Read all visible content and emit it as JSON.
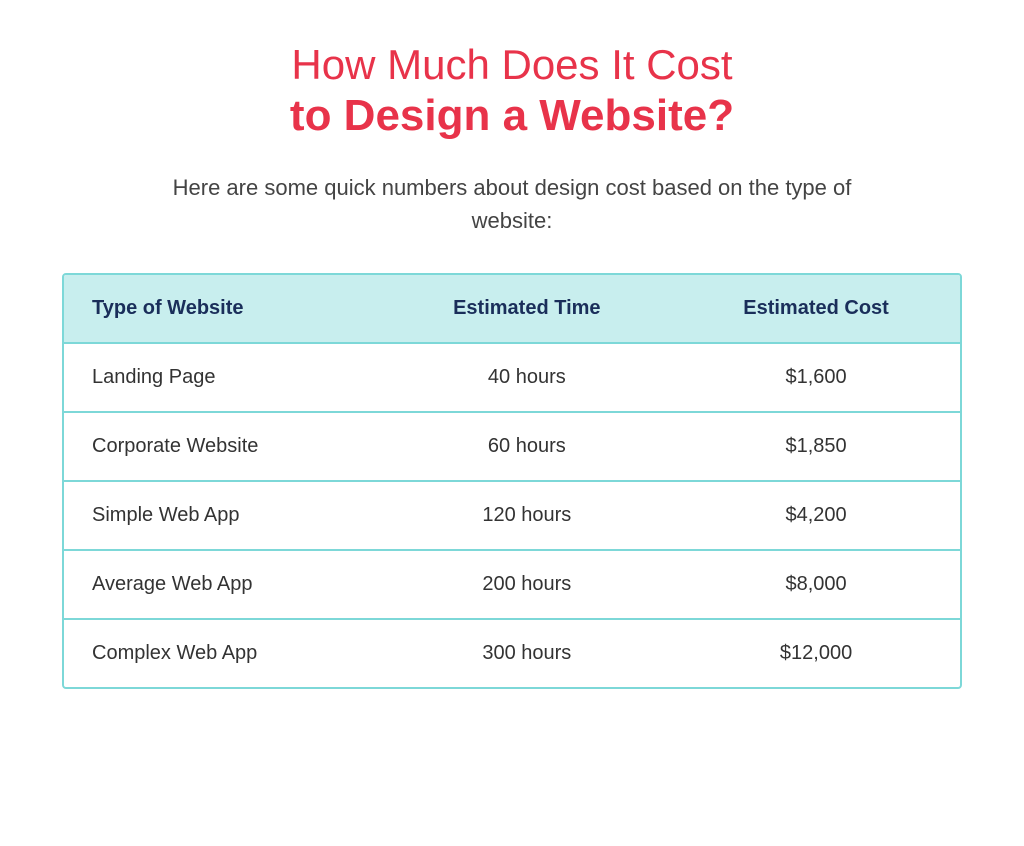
{
  "title": {
    "line1": "How Much Does It Cost",
    "line2": "to Design a Website?"
  },
  "subtitle": "Here are some quick numbers about design cost based on the type of website:",
  "table": {
    "headers": {
      "type": "Type of Website",
      "time": "Estimated Time",
      "cost": "Estimated Cost"
    },
    "rows": [
      {
        "type": "Landing Page",
        "time": "40 hours",
        "cost": "$1,600"
      },
      {
        "type": "Corporate Website",
        "time": "60 hours",
        "cost": "$1,850"
      },
      {
        "type": "Simple Web App",
        "time": "120 hours",
        "cost": "$4,200"
      },
      {
        "type": "Average Web App",
        "time": "200 hours",
        "cost": "$8,000"
      },
      {
        "type": "Complex Web App",
        "time": "300 hours",
        "cost": "$12,000"
      }
    ]
  }
}
